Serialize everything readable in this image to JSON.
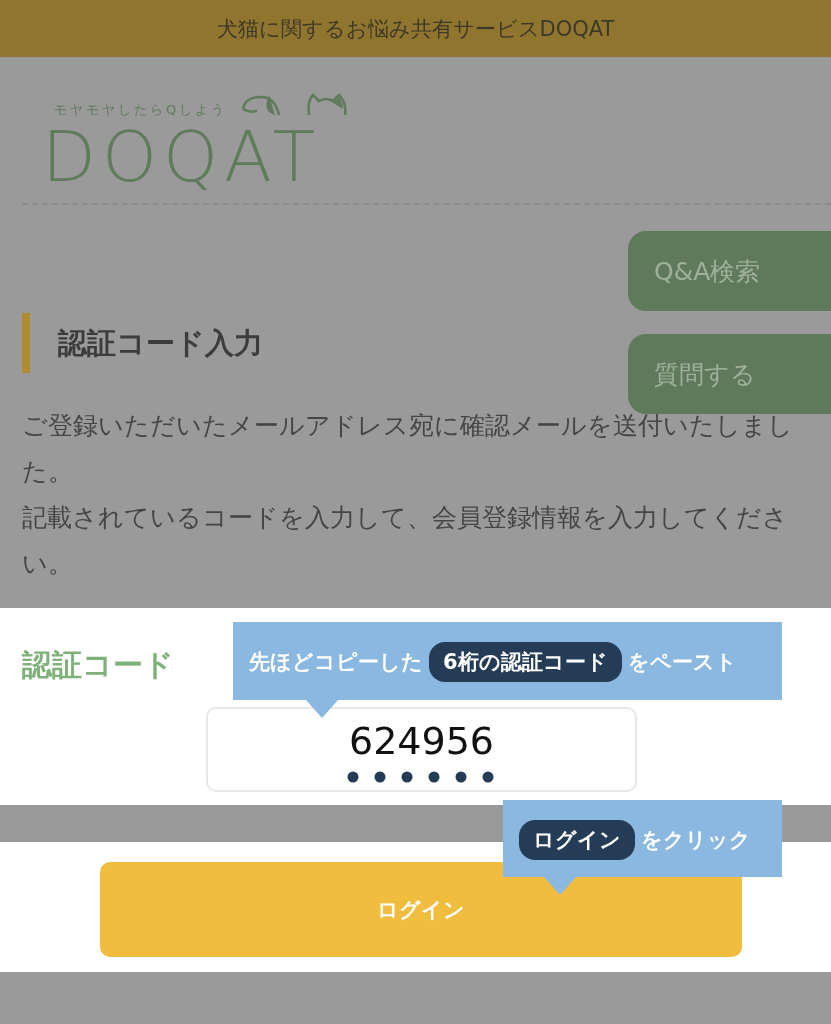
{
  "banner": {
    "text": "犬猫に関するお悩み共有サービスDOQAT"
  },
  "logo": {
    "tagline": "モヤモヤしたらQしよう",
    "wordmark": "DOQAT"
  },
  "floating_buttons": [
    {
      "label": "Q&A検索"
    },
    {
      "label": "質問する"
    }
  ],
  "section": {
    "title": "認証コード入力",
    "paragraphs": [
      "ご登録いただいたメールアドレス宛に確認メールを送付いたしました。",
      "記載されているコードを入力して、会員登録情報を入力してください。"
    ]
  },
  "form": {
    "label": "認証コード",
    "value": "624956",
    "button": "ログイン"
  },
  "callouts": [
    {
      "before": "先ほどコピーした",
      "highlight": "6桁の認証コード",
      "after": "をペースト"
    },
    {
      "highlight": "ログイン",
      "after": "をクリック"
    }
  ]
}
